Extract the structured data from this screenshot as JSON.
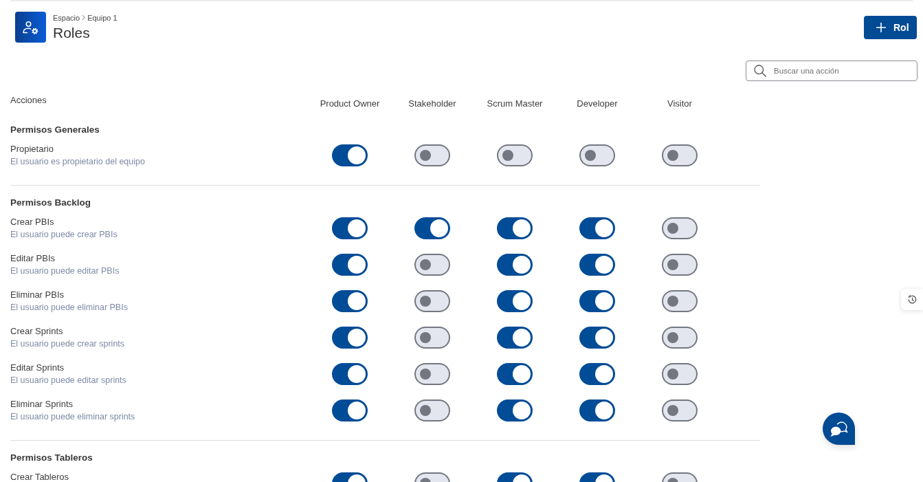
{
  "header": {
    "breadcrumb": [
      "Espacio",
      "Equipo 1"
    ],
    "title": "Roles"
  },
  "add_role_button": {
    "label": "Rol"
  },
  "search": {
    "placeholder": "Buscar una acción"
  },
  "table": {
    "action_header": "Acciones",
    "roles": [
      "Product Owner",
      "Stakeholder",
      "Scrum Master",
      "Developer",
      "Visitor"
    ],
    "sections": [
      {
        "title": "Permisos Generales",
        "rows": [
          {
            "name": "Propietario",
            "description": "El usuario es propietario del equipo",
            "permissions": [
              {
                "on": true
              },
              {
                "on": false
              },
              {
                "on": false
              },
              {
                "on": false
              },
              {
                "on": false
              }
            ]
          }
        ]
      },
      {
        "title": "Permisos Backlog",
        "rows": [
          {
            "name": "Crear PBIs",
            "description": "El usuario puede crear PBIs",
            "permissions": [
              {
                "on": true
              },
              {
                "on": true
              },
              {
                "on": true
              },
              {
                "on": true
              },
              {
                "on": false
              }
            ]
          },
          {
            "name": "Editar PBIs",
            "description": "El usuario puede editar PBIs",
            "permissions": [
              {
                "on": true
              },
              {
                "on": false
              },
              {
                "on": true
              },
              {
                "on": true
              },
              {
                "on": false
              }
            ]
          },
          {
            "name": "Eliminar PBIs",
            "description": "El usuario puede eliminar PBIs",
            "permissions": [
              {
                "on": true
              },
              {
                "on": false
              },
              {
                "on": true
              },
              {
                "on": true
              },
              {
                "on": false
              }
            ]
          },
          {
            "name": "Crear Sprints",
            "description": "El usuario puede crear sprints",
            "permissions": [
              {
                "on": true
              },
              {
                "on": false
              },
              {
                "on": true
              },
              {
                "on": true
              },
              {
                "on": false
              }
            ]
          },
          {
            "name": "Editar Sprints",
            "description": "El usuario puede editar sprints",
            "permissions": [
              {
                "on": true
              },
              {
                "on": false
              },
              {
                "on": true
              },
              {
                "on": true
              },
              {
                "on": false
              }
            ]
          },
          {
            "name": "Eliminar Sprints",
            "description": "El usuario puede eliminar sprints",
            "permissions": [
              {
                "on": true
              },
              {
                "on": false
              },
              {
                "on": true
              },
              {
                "on": true
              },
              {
                "on": false
              }
            ]
          }
        ]
      },
      {
        "title": "Permisos Tableros",
        "rows": [
          {
            "name": "Crear Tableros",
            "permissions": [
              {
                "on": true
              },
              {
                "on": false
              },
              {
                "on": true
              },
              {
                "on": true
              },
              {
                "on": false
              }
            ]
          }
        ]
      }
    ]
  }
}
